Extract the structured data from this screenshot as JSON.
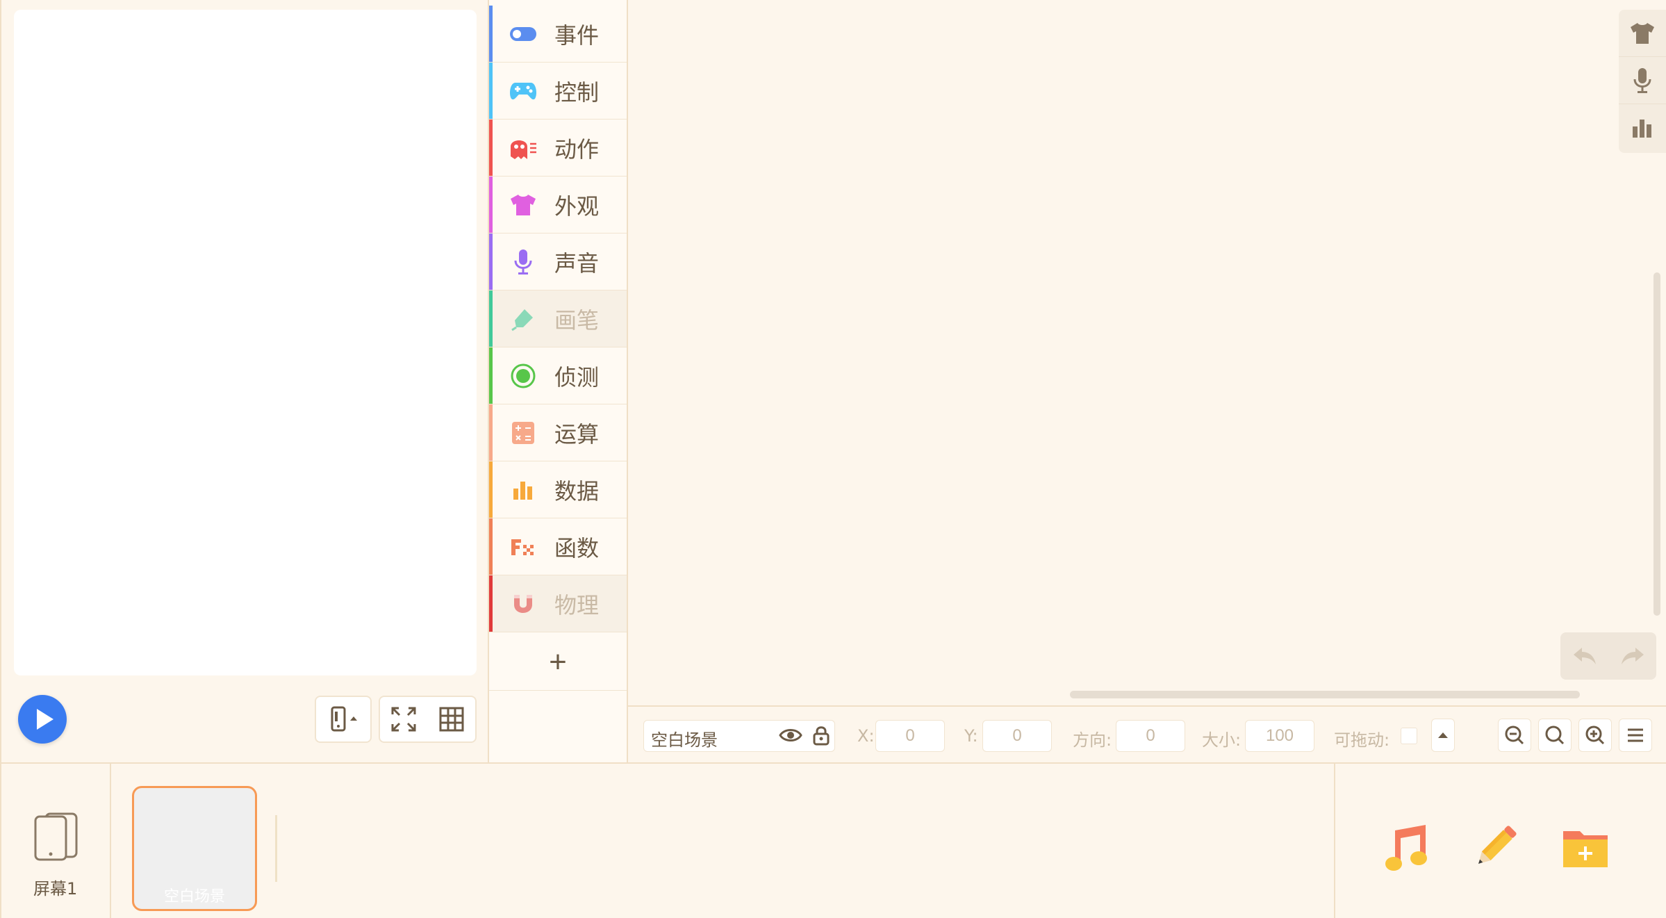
{
  "categories": [
    {
      "label": "事件",
      "color": "#5b8def",
      "icon": "toggle-icon",
      "dim": false
    },
    {
      "label": "控制",
      "color": "#4fc3f7",
      "icon": "gamepad-icon",
      "dim": false
    },
    {
      "label": "动作",
      "color": "#ef5350",
      "icon": "ghost-icon",
      "dim": false
    },
    {
      "label": "外观",
      "color": "#e060e0",
      "icon": "shirt-icon",
      "dim": false
    },
    {
      "label": "声音",
      "color": "#9a6df2",
      "icon": "microphone-icon",
      "dim": false
    },
    {
      "label": "画笔",
      "color": "#41c99a",
      "icon": "pen-icon",
      "dim": true
    },
    {
      "label": "侦测",
      "color": "#58c64a",
      "icon": "radio-target-icon",
      "dim": false
    },
    {
      "label": "运算",
      "color": "#f7a98a",
      "icon": "calculator-icon",
      "dim": false
    },
    {
      "label": "数据",
      "color": "#f7a93b",
      "icon": "bar-chart-icon",
      "dim": false
    },
    {
      "label": "函数",
      "color": "#f08057",
      "icon": "function-icon",
      "dim": false
    },
    {
      "label": "物理",
      "color": "#e03a3a",
      "icon": "magnet-icon",
      "dim": true
    }
  ],
  "add_category_label": "+",
  "property_bar": {
    "sprite_name": "空白场景",
    "x_label": "X:",
    "x_value": "0",
    "y_label": "Y:",
    "y_value": "0",
    "direction_label": "方向:",
    "direction_value": "0",
    "size_label": "大小:",
    "size_value": "100",
    "draggable_label": "可拖动:"
  },
  "bottom": {
    "screen_label": "屏幕1",
    "scene_name": "空白场景"
  },
  "colors": {
    "background": "#fdf6ec",
    "play_button": "#3a7bf0",
    "scene_border": "#f79a55"
  }
}
